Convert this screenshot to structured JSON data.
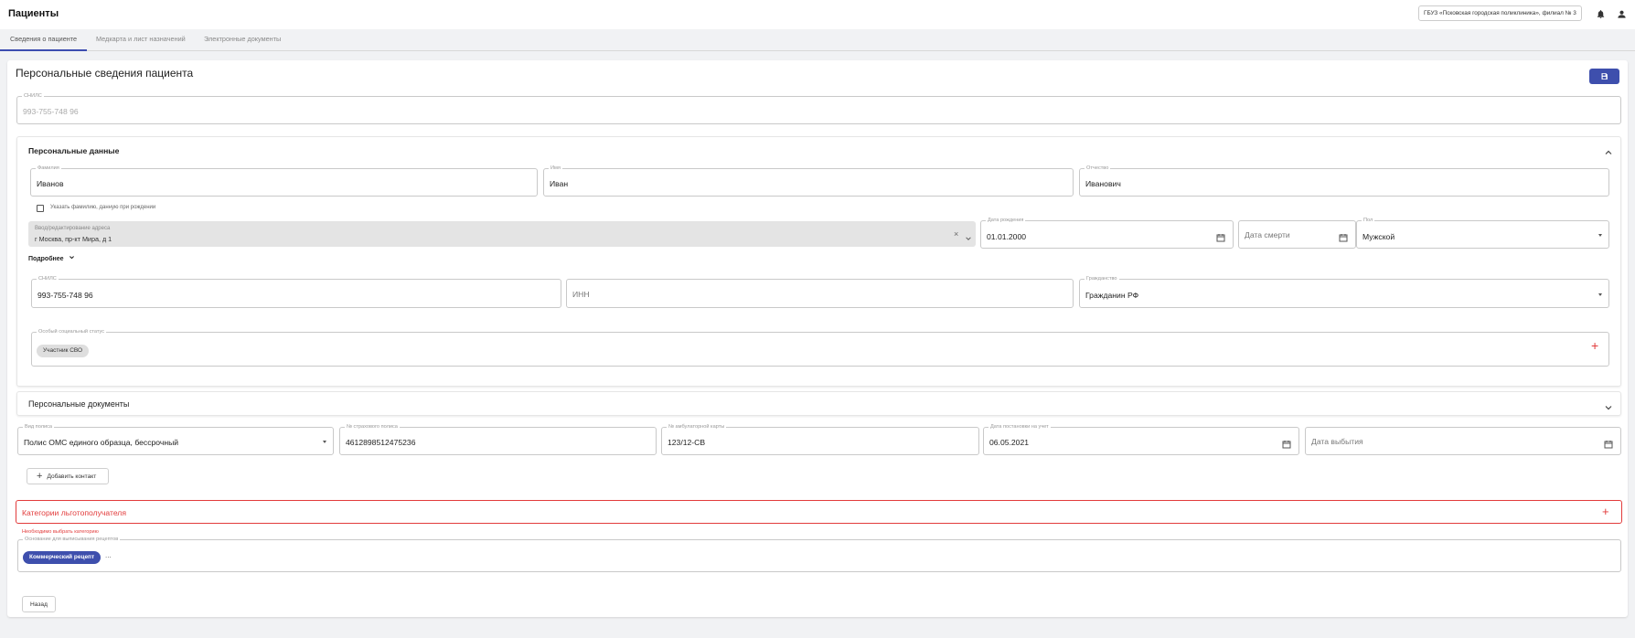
{
  "header": {
    "title": "Пациенты",
    "organization": "ГБУЗ «Псковская городская поликлиника», филиал № 3"
  },
  "tabs": [
    {
      "label": "Сведения о пациенте",
      "active": true
    },
    {
      "label": "Медкарта и лист назначений",
      "active": false
    },
    {
      "label": "Электронные документы",
      "active": false
    }
  ],
  "page": {
    "title": "Персональные сведения пациента",
    "snils_top": {
      "label": "СНИЛС",
      "value": "993-755-748 96"
    }
  },
  "personal": {
    "title": "Персональные данные",
    "last_name": {
      "label": "Фамилия",
      "value": "Иванов"
    },
    "first_name": {
      "label": "Имя",
      "value": "Иван"
    },
    "patronymic": {
      "label": "Отчество",
      "value": "Иванович"
    },
    "birth_name_checkbox": {
      "label": "Указать фамилию, данную при рождении",
      "checked": false
    },
    "address": {
      "label": "Ввод/редактирование адреса",
      "value": "г Москва, пр-кт Мира, д 1"
    },
    "birth_date": {
      "label": "Дата рождения",
      "value": "01.01.2000"
    },
    "death_date": {
      "placeholder": "Дата смерти"
    },
    "sex": {
      "label": "Пол",
      "value": "Мужской"
    },
    "more_link": "Подробнее",
    "snils": {
      "label": "СНИЛС",
      "value": "993-755-748 96"
    },
    "inn": {
      "placeholder": "ИНН"
    },
    "citizenship": {
      "label": "Гражданство",
      "value": "Гражданин РФ"
    },
    "social_status": {
      "label": "Особый социальный статус",
      "chips": [
        "Участник СВО"
      ]
    }
  },
  "documents": {
    "title": "Персональные документы"
  },
  "policy": {
    "type": {
      "label": "Вид полиса",
      "value": "Полис ОМС единого образца, бессрочный"
    },
    "number": {
      "label": "№ страхового полиса",
      "value": "4612898512475236"
    },
    "card_number": {
      "label": "№ амбулаторной карты",
      "value": "123/12-СВ"
    },
    "registration_date": {
      "label": "Дата постановки на учет",
      "value": "06.05.2021"
    },
    "leave_date": {
      "placeholder": "Дата выбытия"
    }
  },
  "add_contact_label": "Добавить контакт",
  "beneficiary": {
    "title": "Категории льготополучателя",
    "error": "Необходимо выбрать категорию",
    "prescription_basis": {
      "label": "Основание для выписывания рецептов",
      "chips": [
        "Коммерческий рецепт"
      ],
      "more": "..."
    }
  },
  "back_label": "Назад",
  "colors": {
    "accent": "#3e4fad",
    "error": "#e23b3b"
  }
}
